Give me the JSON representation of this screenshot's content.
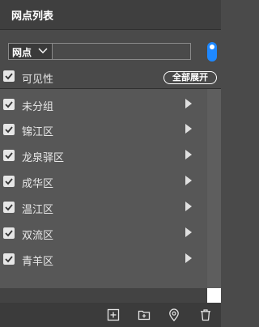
{
  "header": {
    "title": "网点列表"
  },
  "search": {
    "select_value": "网点",
    "placeholder": "",
    "value": ""
  },
  "visibility": {
    "label": "可见性",
    "checked": true,
    "expand_all_label": "全部展开"
  },
  "groups": [
    {
      "label": "未分组",
      "checked": true
    },
    {
      "label": "锦江区",
      "checked": true
    },
    {
      "label": "龙泉驿区",
      "checked": true
    },
    {
      "label": "成华区",
      "checked": true
    },
    {
      "label": "温江区",
      "checked": true
    },
    {
      "label": "双流区",
      "checked": true
    },
    {
      "label": "青羊区",
      "checked": true
    }
  ],
  "toggle": {
    "on": true
  },
  "footer": {
    "buttons": [
      "add-square-icon",
      "add-folder-icon",
      "location-pin-icon",
      "trash-icon"
    ]
  },
  "colors": {
    "accent": "#1e88ff",
    "background": "#4a4a4a",
    "header": "#3f3f3f"
  }
}
